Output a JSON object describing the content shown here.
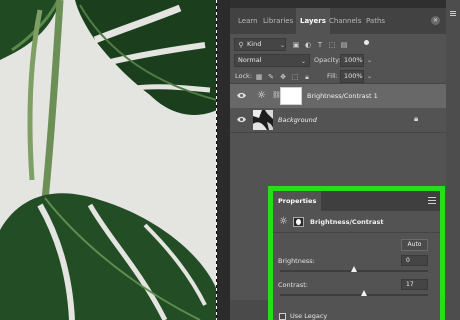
{
  "tabs": [
    {
      "label": "Learn",
      "active": false
    },
    {
      "label": "Libraries",
      "active": false
    },
    {
      "label": "Layers",
      "active": true
    },
    {
      "label": "Channels",
      "active": false
    },
    {
      "label": "Paths",
      "active": false
    }
  ],
  "filter": {
    "label": "Kind",
    "icon": "search-icon"
  },
  "blend_mode": "Normal",
  "opacity": {
    "label": "Opacity:",
    "value": "100%"
  },
  "lock": {
    "label": "Lock:"
  },
  "fill": {
    "label": "Fill:",
    "value": "100%"
  },
  "layers": [
    {
      "name": "Brightness/Contrast 1",
      "visible": true,
      "selected": true,
      "type": "adjustment"
    },
    {
      "name": "Background",
      "visible": true,
      "selected": false,
      "locked": true,
      "italic": true
    }
  ],
  "properties": {
    "tab_label": "Properties",
    "adjustment_title": "Brightness/Contrast",
    "auto_label": "Auto",
    "brightness": {
      "label": "Brightness:",
      "value": "0",
      "level": 0
    },
    "contrast": {
      "label": "Contrast:",
      "value": "17",
      "level": 17
    },
    "use_legacy": {
      "label": "Use Legacy",
      "checked": false
    },
    "highlight_color": "#25e018"
  },
  "colors": {
    "panel": "#535353",
    "selected_layer": "#686868",
    "highlight": "#25e018"
  }
}
